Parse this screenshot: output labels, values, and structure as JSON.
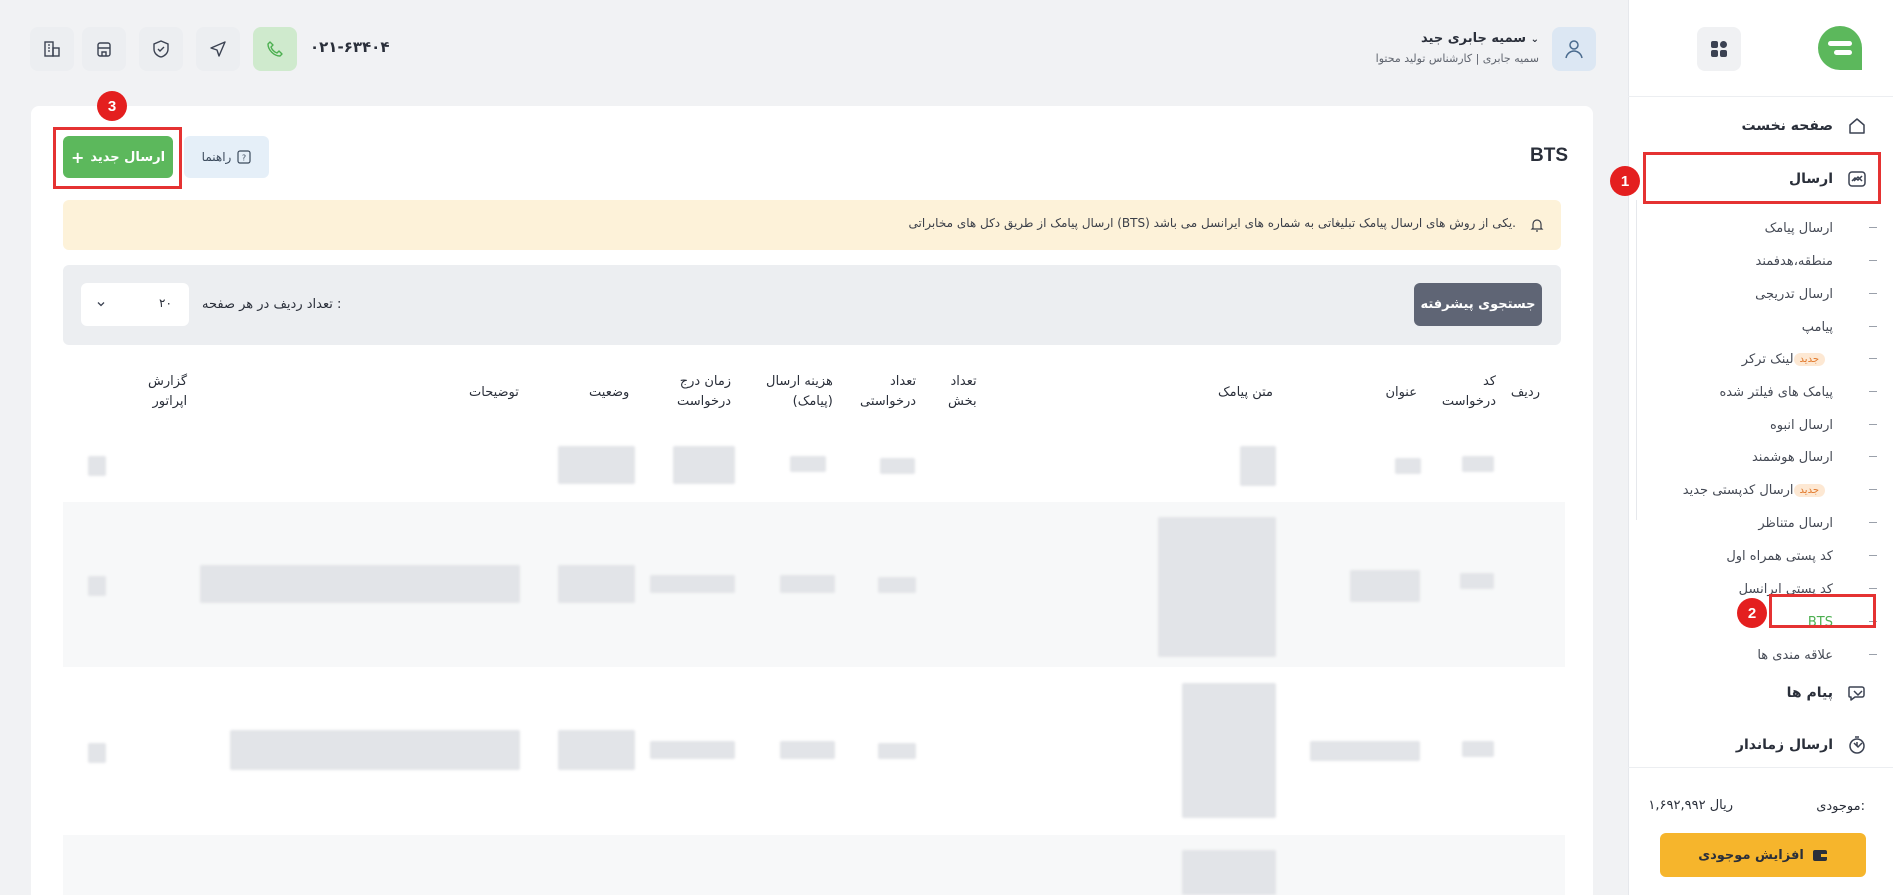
{
  "header": {
    "user_name": "سمیه جابری جید",
    "user_role": "سمیه جابری | کارشناس تولید محتوا",
    "phone": "۰۲۱-۶۳۴۰۴"
  },
  "sidebar": {
    "home": "صفحه نخست",
    "send": "ارسال",
    "send_items": [
      {
        "label": "ارسال پیامک"
      },
      {
        "label": "منطقه،هدفمند"
      },
      {
        "label": "ارسال تدریجی"
      },
      {
        "label": "پیامپ"
      },
      {
        "label": "لینک ترکر",
        "badge": "جدید"
      },
      {
        "label": "پیامک های فیلتر شده"
      },
      {
        "label": "ارسال انبوه"
      },
      {
        "label": "ارسال هوشمند"
      },
      {
        "label": "ارسال کدپستی جدید",
        "badge": "جدید"
      },
      {
        "label": "ارسال متناظر"
      },
      {
        "label": "کد پستی همراه اول"
      },
      {
        "label": "کد پستی ایرانسل"
      },
      {
        "label": "BTS",
        "active": true
      },
      {
        "label": "علاقه مندی ها"
      }
    ],
    "messages": "پیام ها",
    "scheduled": "ارسال زماندار",
    "balance_label": "موجودی:",
    "balance_value": "۱,۶۹۲,۹۹۲ ریال",
    "charge_button": "افزایش موجودی"
  },
  "annotations": [
    "1",
    "2",
    "3"
  ],
  "page": {
    "title": "BTS",
    "new_button": "ارسال جدید",
    "help_button": "راهنما",
    "alert": "ارسال پیامک از طریق دکل های مخابراتی (BTS) یکی از روش های ارسال پیامک تبلیغاتی به شماره های ایرانسل می باشد.",
    "advanced_search": "جستجوی پیشرفته",
    "rows_per_page_label": "تعداد ردیف در هر صفحه :",
    "rows_per_page_value": "۲۰"
  },
  "table": {
    "headers": {
      "row": "ردیف",
      "code": "کد\nدرخواست",
      "title": "عنوان",
      "text": "متن پیامک",
      "parts": "تعداد\nبخش",
      "count": "تعداد\nدرخواستی",
      "cost": "هزینه ارسال\n(پیامک)",
      "time": "زمان درج\nدرخواست",
      "status": "وضعیت",
      "desc": "توضیحات",
      "report": "گزارش\nاپراتور"
    }
  },
  "colors": {
    "accent_green": "#5cb85c",
    "balance_yellow": "#f6b52c",
    "annotation_red": "#e53232",
    "alert_bg": "#fdf2d9"
  }
}
